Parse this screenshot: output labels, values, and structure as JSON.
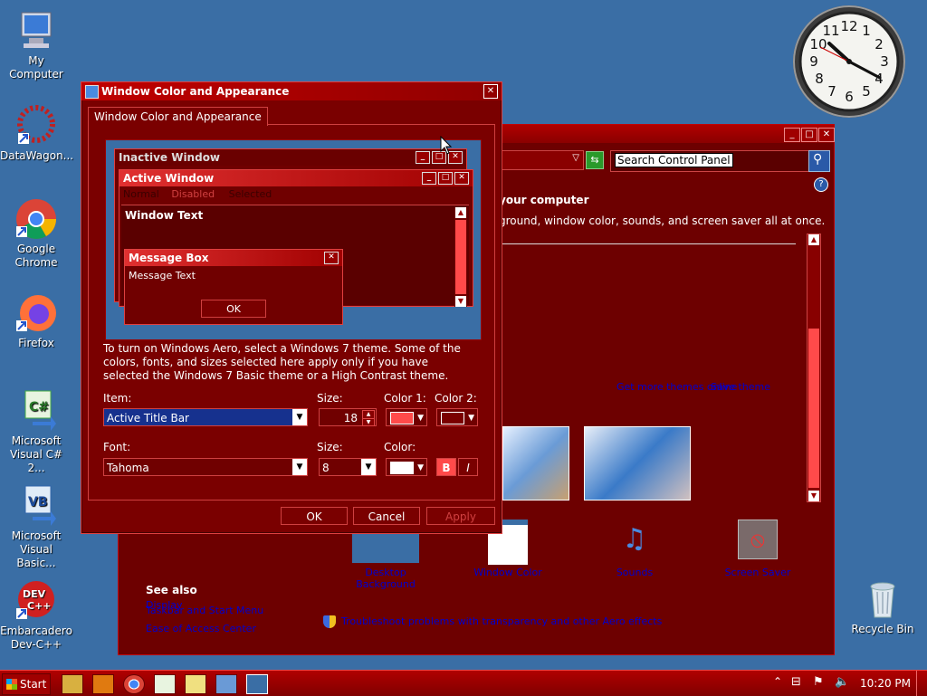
{
  "desktop": {
    "icons": [
      {
        "label": "My Computer"
      },
      {
        "label": "DataWagon..."
      },
      {
        "label": "Google Chrome"
      },
      {
        "label": "Firefox"
      },
      {
        "label": "Microsoft Visual C# 2..."
      },
      {
        "label": "Microsoft Visual Basic..."
      },
      {
        "label": "Embarcadero Dev-C++"
      }
    ],
    "recycle_bin": "Recycle Bin"
  },
  "clock": {
    "numerals": [
      "12",
      "1",
      "2",
      "3",
      "4",
      "5",
      "6",
      "7",
      "8",
      "9",
      "10",
      "11"
    ]
  },
  "control_panel": {
    "search_placeholder": "Search Control Panel",
    "heading": "your computer",
    "description": "ground, window color, sounds, and screen saver all at once.",
    "links": {
      "get_themes": "Get more themes online",
      "save_theme": "Save theme"
    },
    "bottom_items": [
      "Desktop Background",
      "Window Color",
      "Sounds",
      "Screen Saver"
    ],
    "see_also": {
      "title": "See also",
      "items": [
        "Display",
        "Taskbar and Start Menu",
        "Ease of Access Center"
      ]
    },
    "troubleshoot": "Troubleshoot problems with transparency and other Aero effects"
  },
  "dialog": {
    "title": "Window Color and Appearance",
    "tab": "Window Color and Appearance",
    "preview": {
      "inactive_window": "Inactive Window",
      "active_window": "Active Window",
      "menu": [
        "Normal",
        "Disabled",
        "Selected"
      ],
      "window_text": "Window Text",
      "message_box": "Message Box",
      "message_text": "Message Text",
      "ok": "OK"
    },
    "info_text": "To turn on Windows Aero, select a Windows 7 theme.  Some of the colors, fonts, and sizes selected here apply only if you have selected the Windows 7 Basic theme or a High Contrast theme.",
    "labels": {
      "item": "Item:",
      "size": "Size:",
      "color1": "Color 1:",
      "color2": "Color 2:",
      "font": "Font:",
      "font_size": "Size:",
      "color": "Color:"
    },
    "item_value": "Active Title Bar",
    "size_value": "18",
    "font_value": "Tahoma",
    "font_size_value": "8",
    "bold": "B",
    "italic": "I",
    "buttons": {
      "ok": "OK",
      "cancel": "Cancel",
      "apply": "Apply"
    },
    "colors": {
      "color1": "#ff4a4a",
      "color2": "#7a0000",
      "font_color": "#ffffff"
    }
  },
  "taskbar": {
    "start": "Start",
    "time": "10:20 PM"
  }
}
